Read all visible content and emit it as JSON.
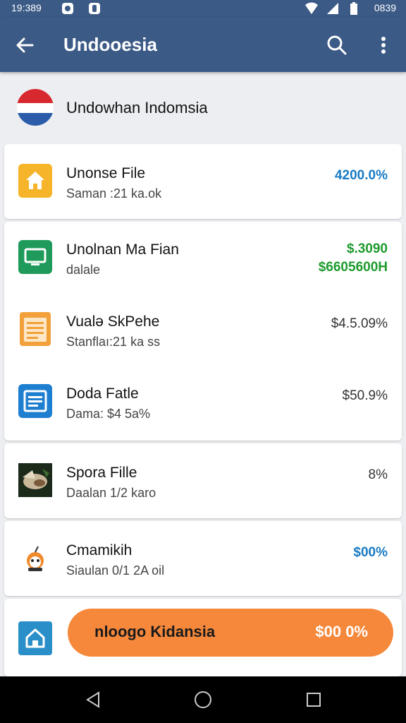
{
  "status_bar": {
    "time": "19:389",
    "right_time": "0839",
    "icons": [
      "notification-icon",
      "camera-icon",
      "wifi-icon",
      "signal-icon",
      "battery-icon"
    ]
  },
  "app_bar": {
    "title": "Undooesia",
    "icons": [
      "back-arrow-icon",
      "search-icon",
      "more-vert-icon"
    ]
  },
  "header": {
    "label": "Undowhan Indomsia",
    "flag_colors": [
      "#d7282f",
      "#ffffff",
      "#2a5caa"
    ]
  },
  "items": [
    {
      "name": "Unonse File",
      "sub": "Saman :21 ka.ok",
      "value": "4200.0%",
      "value_color": "#1a7bc4",
      "icon": "home-icon"
    },
    {
      "name": "Unolnan Ma Fian",
      "sub": "dalale",
      "value": "$.3090",
      "value2": "$6605600H",
      "value_color": "#1e9b2e",
      "icon": "monitor-icon"
    },
    {
      "name": "Vualə SkPehe",
      "sub": "Stanflaı:21 ka ss",
      "value": "$4.5.09%",
      "value_color": "#333333",
      "icon": "document-icon"
    },
    {
      "name": "Doda Fatle",
      "sub": "Dama: $4 5a%",
      "value": "$50.9%",
      "value_color": "#333333",
      "icon": "list-icon"
    },
    {
      "name": "Spora Fille",
      "sub": "Daalan 1/2 karo",
      "value": "8%",
      "value_color": "#333333",
      "icon": "food-photo-icon"
    },
    {
      "name": "Cmamikih",
      "sub": "Siaulan 0/1 2A oil",
      "value": "$00%",
      "value_color": "#1a7bc4",
      "icon": "character-icon"
    }
  ],
  "promo": {
    "text": "nloogo Kidansia",
    "value": "$00 0%",
    "icon": "home-outline-icon"
  },
  "nav_bar": {
    "icons": [
      "back-triangle-icon",
      "home-circle-icon",
      "recents-square-icon"
    ]
  }
}
